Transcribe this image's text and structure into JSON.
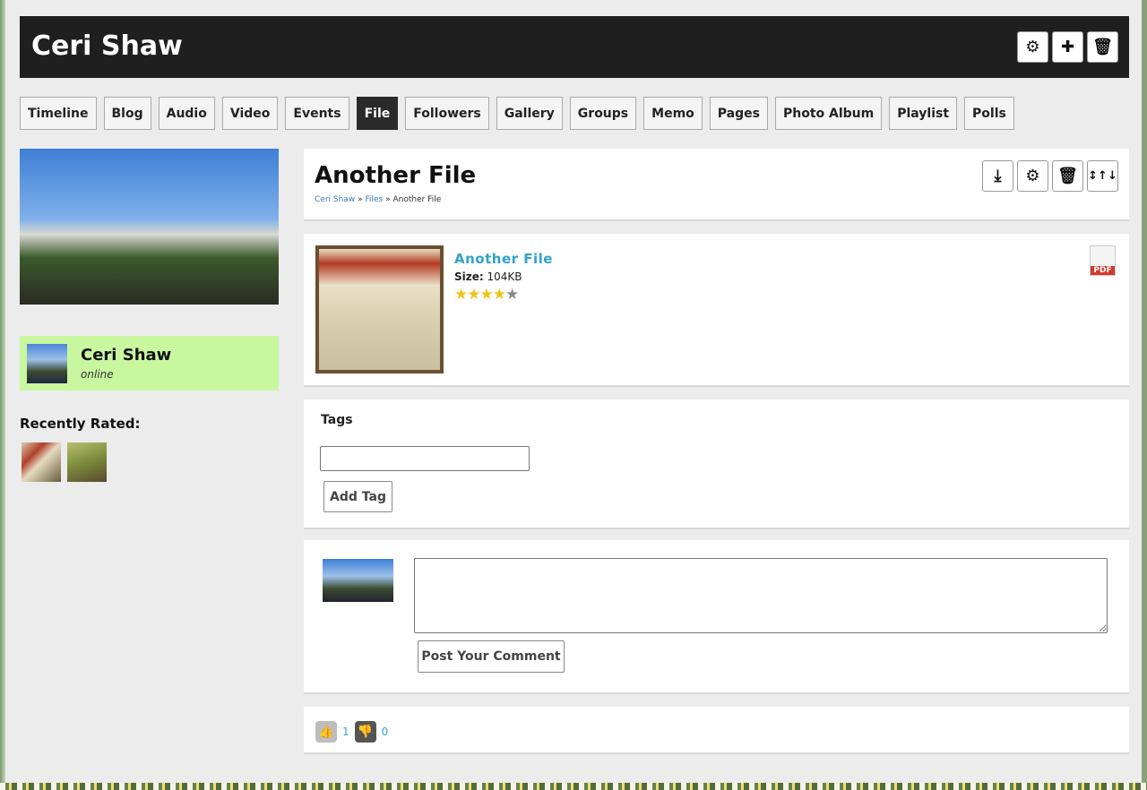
{
  "header": {
    "title": "Ceri Shaw",
    "buttons": [
      "settings",
      "add",
      "delete"
    ]
  },
  "tabs": [
    "Timeline",
    "Blog",
    "Audio",
    "Video",
    "Events",
    "File",
    "Followers",
    "Gallery",
    "Groups",
    "Memo",
    "Pages",
    "Photo Album",
    "Playlist",
    "Polls"
  ],
  "active_tab": "File",
  "sidebar": {
    "user_name": "Ceri Shaw",
    "user_status": "online",
    "recently_rated_label": "Recently Rated:"
  },
  "file": {
    "title": "Another File",
    "breadcrumb": {
      "home": "Ceri Shaw",
      "sep": "»",
      "section": "Files",
      "current": "Another File"
    },
    "name": "Another File",
    "size_label": "Size:",
    "size": "104KB",
    "rating": 4,
    "rating_max": 5,
    "type_badge": "PDF"
  },
  "tags": {
    "label": "Tags",
    "input_value": "",
    "add_button": "Add Tag"
  },
  "comment": {
    "value": "",
    "post_button": "Post Your Comment"
  },
  "reactions": {
    "likes": "1",
    "dislikes": "0"
  }
}
